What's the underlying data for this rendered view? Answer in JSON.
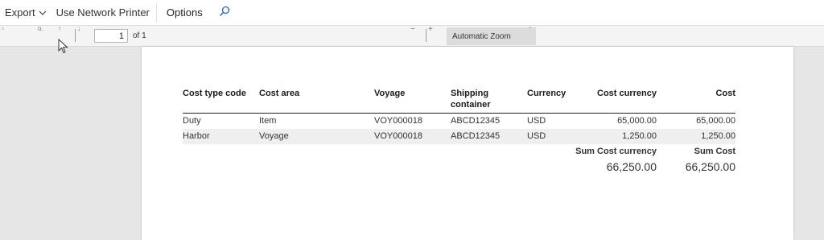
{
  "actionbar": {
    "export_label": "Export",
    "network_printer_label": "Use Network Printer",
    "options_label": "Options"
  },
  "pdf_toolbar": {
    "page_number": "1",
    "page_of": "of 1",
    "zoom_minus": "−",
    "zoom_plus": "+",
    "zoom_value": "Automatic Zoom"
  },
  "report": {
    "headers": {
      "cost_type_code": "Cost type code",
      "cost_area": "Cost area",
      "voyage": "Voyage",
      "shipping_container": "Shipping container",
      "currency": "Currency",
      "cost_currency": "Cost currency",
      "cost": "Cost"
    },
    "rows": [
      {
        "cost_type_code": "Duty",
        "cost_area": "Item",
        "voyage": "VOY000018",
        "shipping_container": "ABCD12345",
        "currency": "USD",
        "cost_currency": "65,000.00",
        "cost": "65,000.00"
      },
      {
        "cost_type_code": "Harbor",
        "cost_area": "Voyage",
        "voyage": "VOY000018",
        "shipping_container": "ABCD12345",
        "currency": "USD",
        "cost_currency": "1,250.00",
        "cost": "1,250.00"
      }
    ],
    "totals": {
      "sum_cost_currency_label": "Sum Cost currency",
      "sum_cost_label": "Sum Cost",
      "sum_cost_currency_value": "66,250.00",
      "sum_cost_value": "66,250.00"
    }
  }
}
